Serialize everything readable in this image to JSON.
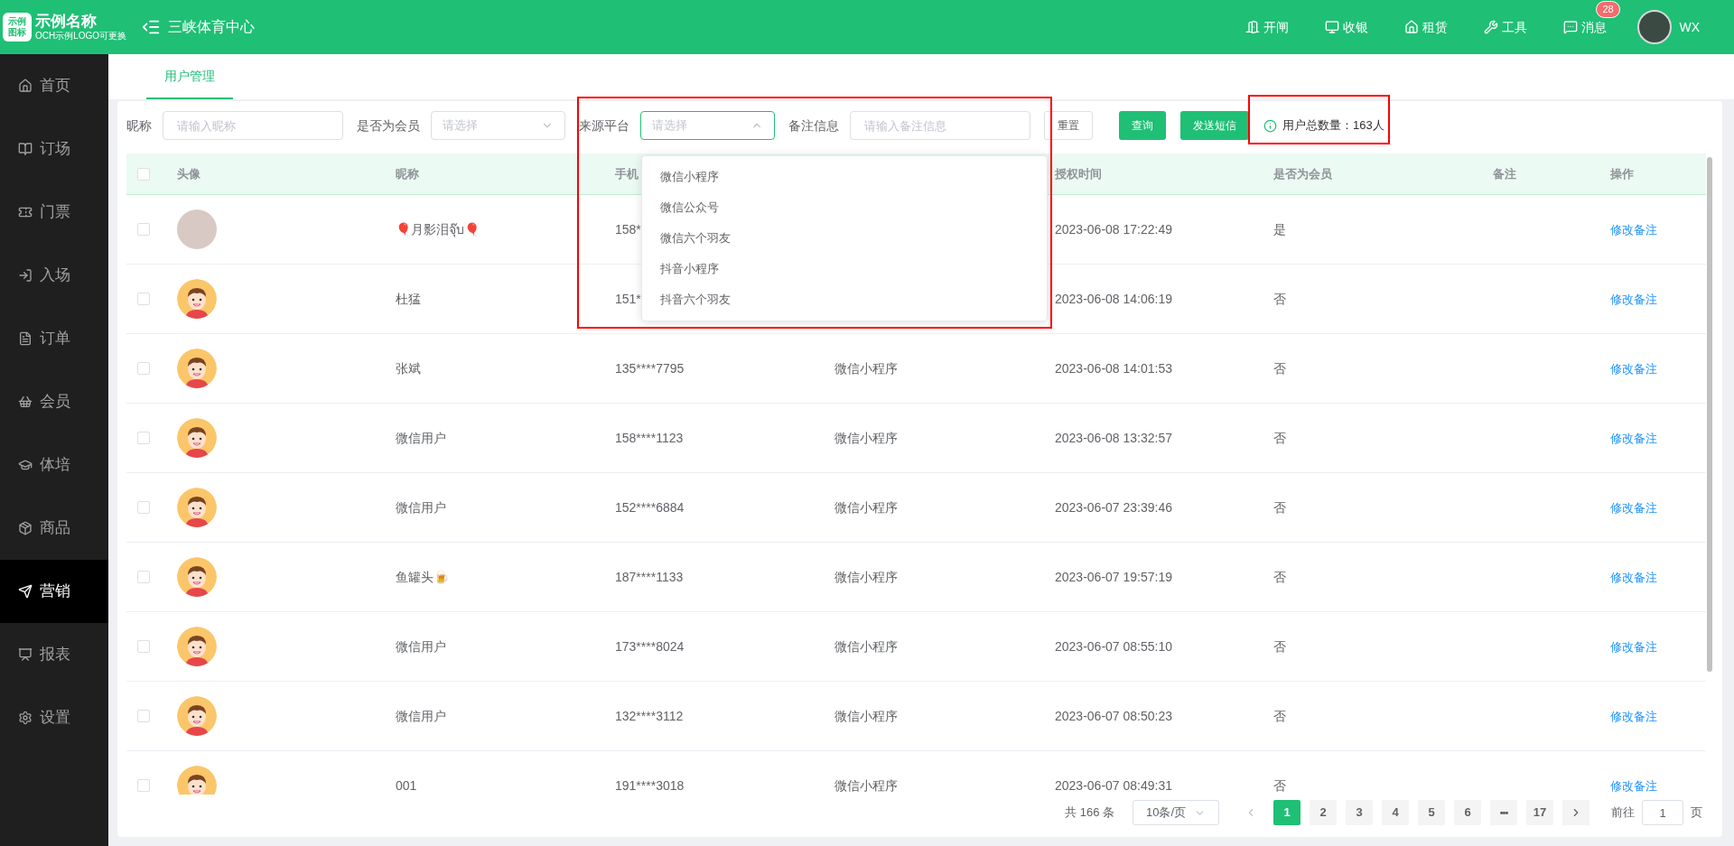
{
  "header": {
    "logo_mark": "示例图标",
    "logo_title": "示例名称",
    "logo_subtitle": "OCH示例LOGO可更换",
    "venue": "三峡体育中心",
    "actions": [
      {
        "kind": "gate",
        "label": "开闸"
      },
      {
        "kind": "cashier",
        "label": "收银"
      },
      {
        "kind": "rent",
        "label": "租赁"
      },
      {
        "kind": "tools",
        "label": "工具"
      },
      {
        "kind": "messages",
        "label": "消息",
        "badge": "28"
      }
    ],
    "user": "WX"
  },
  "sidebar": {
    "items": [
      {
        "kind": "home",
        "label": "首页",
        "selected": false
      },
      {
        "kind": "booking",
        "label": "订场",
        "selected": false
      },
      {
        "kind": "ticket",
        "label": "门票",
        "selected": false
      },
      {
        "kind": "entry",
        "label": "入场",
        "selected": false
      },
      {
        "kind": "order",
        "label": "订单",
        "selected": false
      },
      {
        "kind": "member",
        "label": "会员",
        "selected": false
      },
      {
        "kind": "training",
        "label": "体培",
        "selected": false
      },
      {
        "kind": "goods",
        "label": "商品",
        "selected": false
      },
      {
        "kind": "marketing",
        "label": "营销",
        "selected": true
      },
      {
        "kind": "report",
        "label": "报表",
        "selected": false
      },
      {
        "kind": "settings",
        "label": "设置",
        "selected": false
      }
    ]
  },
  "tabs": [
    {
      "label": "用户管理",
      "selected": true
    }
  ],
  "filters": [
    {
      "kind": "input",
      "label": "昵称",
      "placeholder": "请输入昵称"
    },
    {
      "kind": "select",
      "label": "是否为会员",
      "placeholder": "请选择",
      "expanded": false
    },
    {
      "kind": "select",
      "label": "来源平台",
      "placeholder": "请选择",
      "expanded": true,
      "options": [
        "微信小程序",
        "微信公众号",
        "微信六个羽友",
        "抖音小程序",
        "抖音六个羽友"
      ]
    },
    {
      "kind": "input",
      "label": "备注信息",
      "placeholder": "请输入备注信息"
    }
  ],
  "buttons": [
    {
      "kind": "plain",
      "label": "重置"
    },
    {
      "kind": "primary",
      "label": "查询"
    },
    {
      "kind": "primary",
      "label": "发送短信"
    }
  ],
  "total": "用户总数量：163人",
  "table": {
    "all_checked": false,
    "columns": [
      {
        "label": "头像"
      },
      {
        "label": "昵称"
      },
      {
        "label": "手机"
      },
      {},
      {
        "label": "授权时间"
      },
      {
        "label": "是否为会员"
      },
      {
        "label": "备注"
      },
      {
        "label": "操作"
      }
    ],
    "rows": [
      {
        "checked": false,
        "avatar": {
          "kind": "photo"
        },
        "nickname": "🎈月影泪จุ๊บ🎈",
        "phone": "158*",
        "time": "2023-06-08 17:22:49",
        "member": "是",
        "action": "修改备注"
      },
      {
        "checked": false,
        "avatar": {
          "kind": "cartoon"
        },
        "nickname": "杜猛",
        "phone": "151*",
        "time": "2023-06-08 14:06:19",
        "member": "否",
        "action": "修改备注"
      },
      {
        "checked": false,
        "avatar": {
          "kind": "cartoon"
        },
        "nickname": "张斌",
        "phone": "135****7795",
        "platform": "微信小程序",
        "time": "2023-06-08 14:01:53",
        "member": "否",
        "action": "修改备注"
      },
      {
        "checked": false,
        "avatar": {
          "kind": "cartoon"
        },
        "nickname": "微信用户",
        "phone": "158****1123",
        "platform": "微信小程序",
        "time": "2023-06-08 13:32:57",
        "member": "否",
        "action": "修改备注"
      },
      {
        "checked": false,
        "avatar": {
          "kind": "cartoon"
        },
        "nickname": "微信用户",
        "phone": "152****6884",
        "platform": "微信小程序",
        "time": "2023-06-07 23:39:46",
        "member": "否",
        "action": "修改备注"
      },
      {
        "checked": false,
        "avatar": {
          "kind": "cartoon"
        },
        "nickname": "鱼罐头🍺",
        "phone": "187****1133",
        "platform": "微信小程序",
        "time": "2023-06-07 19:57:19",
        "member": "否",
        "action": "修改备注"
      },
      {
        "checked": false,
        "avatar": {
          "kind": "cartoon"
        },
        "nickname": "微信用户",
        "phone": "173****8024",
        "platform": "微信小程序",
        "time": "2023-06-07 08:55:10",
        "member": "否",
        "action": "修改备注"
      },
      {
        "checked": false,
        "avatar": {
          "kind": "cartoon"
        },
        "nickname": "微信用户",
        "phone": "132****3112",
        "platform": "微信小程序",
        "time": "2023-06-07 08:50:23",
        "member": "否",
        "action": "修改备注"
      },
      {
        "checked": false,
        "avatar": {
          "kind": "cartoon"
        },
        "nickname": "001",
        "phone": "191****3018",
        "platform": "微信小程序",
        "time": "2023-06-07 08:49:31",
        "member": "否",
        "action": "修改备注"
      }
    ]
  },
  "pagination": {
    "total": "共 166 条",
    "page_size": "10条/页",
    "pages": [
      {
        "kind": "page",
        "label": "1",
        "selected": true
      },
      {
        "kind": "page",
        "label": "2",
        "selected": false
      },
      {
        "kind": "page",
        "label": "3",
        "selected": false
      },
      {
        "kind": "page",
        "label": "4",
        "selected": false
      },
      {
        "kind": "page",
        "label": "5",
        "selected": false
      },
      {
        "kind": "page",
        "label": "6",
        "selected": false
      },
      {
        "kind": "more",
        "label": "•••",
        "selected": false
      },
      {
        "kind": "page",
        "label": "17",
        "selected": false
      }
    ],
    "goto_label": "前往",
    "goto_value": "1",
    "goto_suffix": "页"
  }
}
